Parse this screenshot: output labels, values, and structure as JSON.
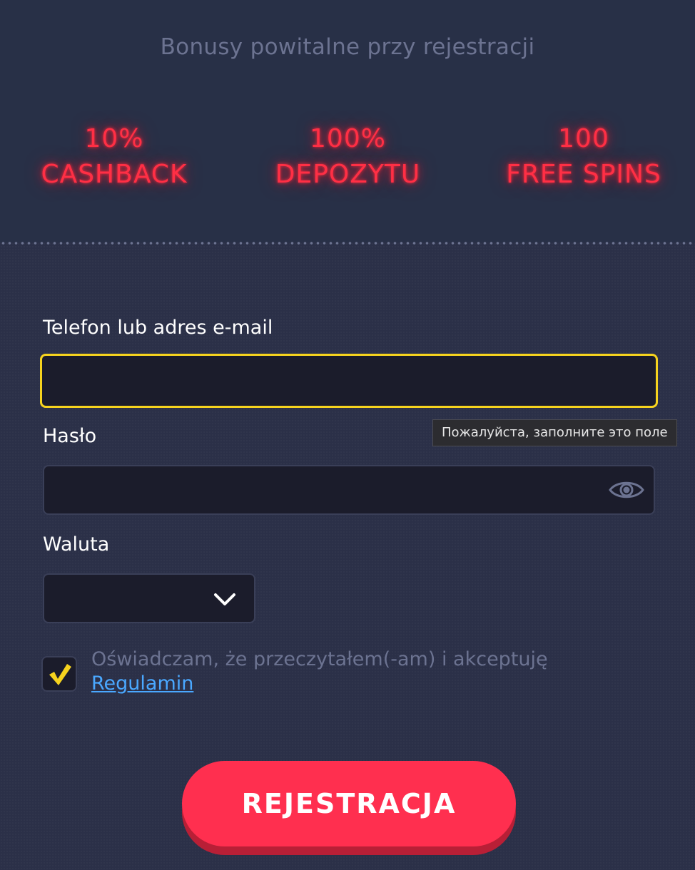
{
  "bonuses": {
    "title": "Bonusy powitalne przy rejestracji",
    "items": [
      {
        "line1": "10%",
        "line2": "CASHBACK"
      },
      {
        "line1": "100%",
        "line2": "DEPOZYTU"
      },
      {
        "line1": "100",
        "line2": "FREE SPINS"
      }
    ]
  },
  "form": {
    "email_label": "Telefon lub adres e-mail",
    "email_value": "",
    "password_label": "Hasło",
    "password_value": "",
    "currency_label": "Waluta",
    "currency_value": "",
    "validation_tooltip": "Пожалуйста, заполните это поле",
    "consent_text": "Oświadczam, że przeczytałem(-am) i akceptuję",
    "consent_link": "Regulamin",
    "consent_checked": true,
    "submit_label": "REJESTRACJA"
  },
  "colors": {
    "background": "#2b3048",
    "neon_red": "#ff2f45",
    "focus_yellow": "#f6d31e",
    "button_red": "#ff2f4f",
    "link_blue": "#4aa8ff"
  },
  "icons": {
    "password_toggle": "eye-icon",
    "select_arrow": "chevron-down-icon",
    "checkbox_mark": "check-icon"
  }
}
